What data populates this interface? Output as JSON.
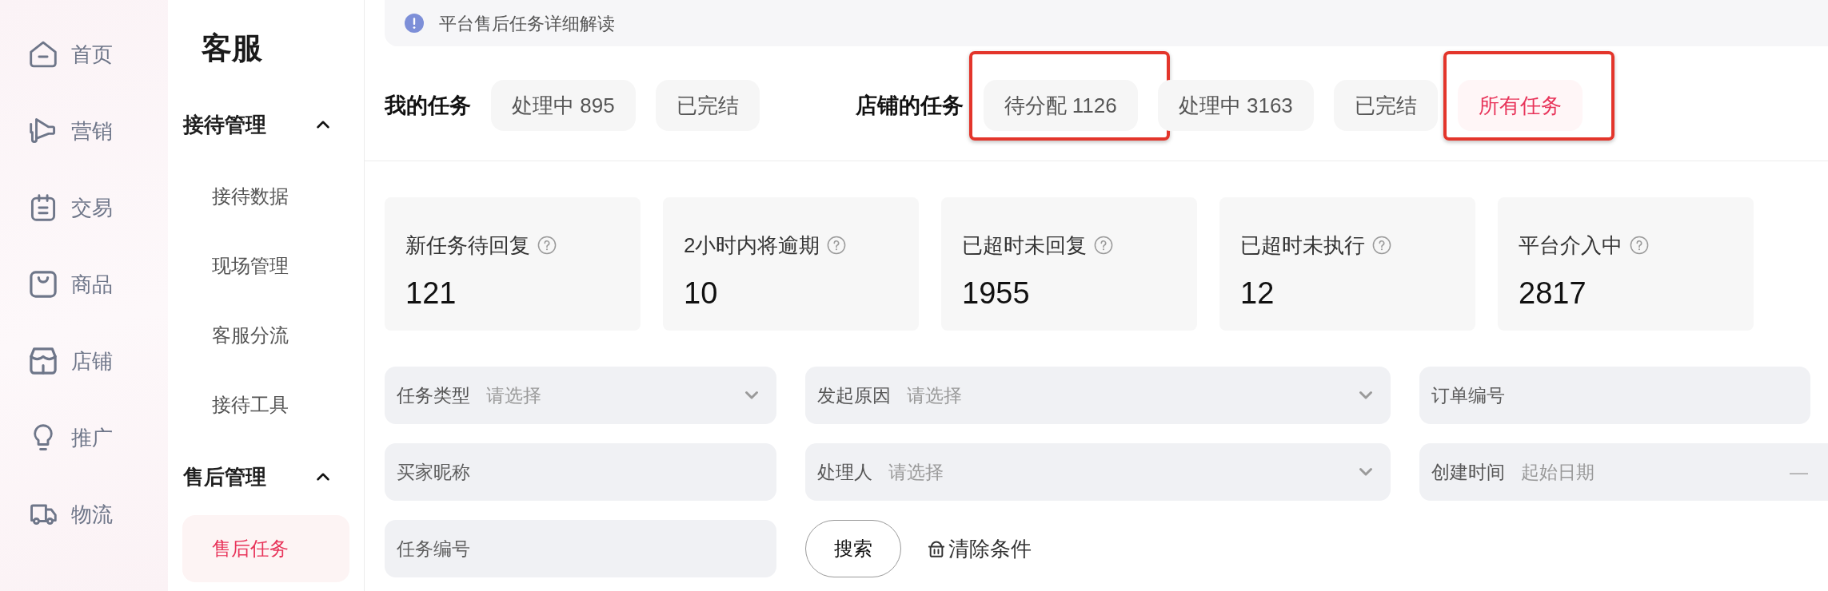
{
  "rail": {
    "items": [
      {
        "label": "首页",
        "selected": false
      },
      {
        "label": "营销",
        "selected": false
      },
      {
        "label": "交易",
        "selected": false
      },
      {
        "label": "商品",
        "selected": false
      },
      {
        "label": "店铺",
        "selected": false
      },
      {
        "label": "推广",
        "selected": false
      },
      {
        "label": "物流",
        "selected": false
      }
    ]
  },
  "sidebar": {
    "title": "客服",
    "groups": [
      {
        "label": "接待管理",
        "expanded": true,
        "items": [
          {
            "label": "接待数据",
            "selected": false
          },
          {
            "label": "现场管理",
            "selected": false
          },
          {
            "label": "客服分流",
            "selected": false
          },
          {
            "label": "接待工具",
            "selected": false
          }
        ]
      },
      {
        "label": "售后管理",
        "expanded": true,
        "items": [
          {
            "label": "售后任务",
            "selected": true
          }
        ]
      }
    ]
  },
  "notice": {
    "text": "平台售后任务详细解读"
  },
  "task_tabs": {
    "groups": [
      {
        "label": "我的任务",
        "tabs": [
          {
            "label": "处理中 895",
            "selected": false,
            "annotated": false
          },
          {
            "label": "已完结",
            "selected": false,
            "annotated": false
          }
        ]
      },
      {
        "label": "店铺的任务",
        "tabs": [
          {
            "label": "待分配 1126",
            "selected": false,
            "annotated": true
          },
          {
            "label": "处理中 3163",
            "selected": false,
            "annotated": false
          },
          {
            "label": "已完结",
            "selected": false,
            "annotated": false
          },
          {
            "label": "所有任务",
            "selected": true,
            "annotated": true
          }
        ]
      }
    ]
  },
  "stats": [
    {
      "label": "新任务待回复",
      "value": "121"
    },
    {
      "label": "2小时内将逾期",
      "value": "10"
    },
    {
      "label": "已超时未回复",
      "value": "1955"
    },
    {
      "label": "已超时未执行",
      "value": "12"
    },
    {
      "label": "平台介入中",
      "value": "2817"
    }
  ],
  "filters": [
    {
      "kind": "select",
      "label": "任务类型",
      "placeholder": "请选择"
    },
    {
      "kind": "select",
      "label": "发起原因",
      "placeholder": "请选择"
    },
    {
      "kind": "text",
      "placeholder": "订单编号"
    },
    {
      "kind": "text",
      "placeholder": "买家昵称"
    },
    {
      "kind": "select",
      "label": "处理人",
      "placeholder": "请选择"
    },
    {
      "kind": "daterange",
      "label": "创建时间",
      "placeholder": "起始日期",
      "separator": "—"
    },
    {
      "kind": "text",
      "placeholder": "任务编号"
    }
  ],
  "actions": {
    "search": "搜索",
    "clear": "清除条件"
  }
}
